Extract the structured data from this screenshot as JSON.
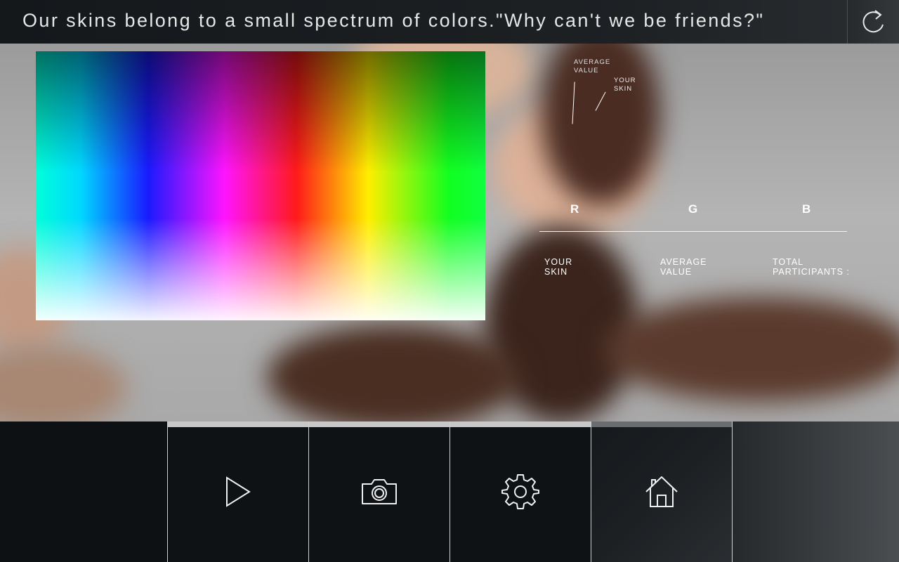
{
  "header": {
    "title": "Our skins belong to a small spectrum of colors.\"Why can't we be friends?\"",
    "refresh_icon": "refresh-icon"
  },
  "legend": {
    "average_value": "AVERAGE\nVALUE",
    "your_skin": "YOUR\nSKIN"
  },
  "rgb": {
    "r": "R",
    "g": "G",
    "b": "B"
  },
  "stats": {
    "your_skin": "YOUR\nSKIN",
    "average_value": "AVERAGE\nVALUE",
    "total_participants": "TOTAL\nPARTICIPANTS :"
  },
  "nav": [
    {
      "name": "play",
      "icon": "play-icon"
    },
    {
      "name": "camera",
      "icon": "camera-icon"
    },
    {
      "name": "settings",
      "icon": "gear-icon"
    },
    {
      "name": "home",
      "icon": "home-icon"
    }
  ],
  "colors": {
    "accent": "#ffffff",
    "bar_background": "#0e1113",
    "active_tab_indicator": "#c8c8c8"
  }
}
